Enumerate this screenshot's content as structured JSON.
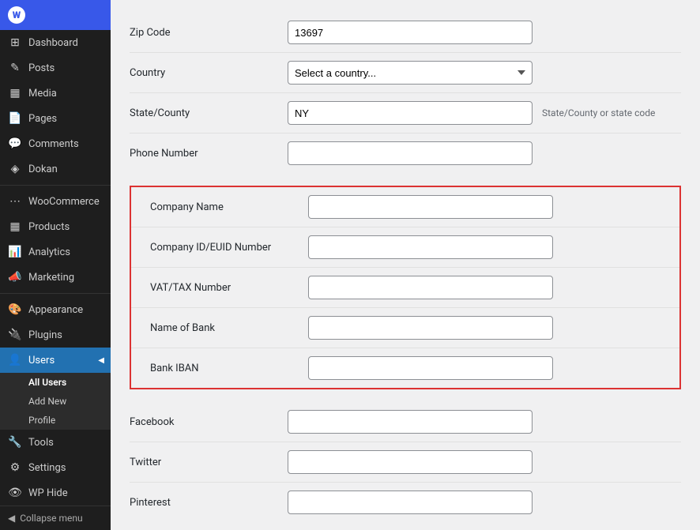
{
  "sidebar": {
    "logo": "W",
    "items": [
      {
        "id": "dashboard",
        "label": "Dashboard",
        "icon": "⊞"
      },
      {
        "id": "posts",
        "label": "Posts",
        "icon": "✎"
      },
      {
        "id": "media",
        "label": "Media",
        "icon": "🖼"
      },
      {
        "id": "pages",
        "label": "Pages",
        "icon": "📄"
      },
      {
        "id": "comments",
        "label": "Comments",
        "icon": "💬"
      },
      {
        "id": "dokan",
        "label": "Dokan",
        "icon": "🏪"
      },
      {
        "id": "woocommerce",
        "label": "WooCommerce",
        "icon": "🛒"
      },
      {
        "id": "products",
        "label": "Products",
        "icon": "📦"
      },
      {
        "id": "analytics",
        "label": "Analytics",
        "icon": "📊"
      },
      {
        "id": "marketing",
        "label": "Marketing",
        "icon": "📣"
      },
      {
        "id": "appearance",
        "label": "Appearance",
        "icon": "🎨"
      },
      {
        "id": "plugins",
        "label": "Plugins",
        "icon": "🔌"
      },
      {
        "id": "users",
        "label": "Users",
        "icon": "👤",
        "active": true
      },
      {
        "id": "tools",
        "label": "Tools",
        "icon": "🔧"
      },
      {
        "id": "settings",
        "label": "Settings",
        "icon": "⚙"
      },
      {
        "id": "wphide",
        "label": "WP Hide",
        "icon": "👁"
      }
    ],
    "submenu": {
      "all_users": "All Users",
      "add_new": "Add New",
      "profile": "Profile"
    },
    "collapse": "Collapse menu"
  },
  "form": {
    "fields": [
      {
        "id": "zip-code",
        "label": "Zip Code",
        "value": "13697",
        "type": "text",
        "hint": ""
      },
      {
        "id": "country",
        "label": "Country",
        "value": "Select a country...",
        "type": "select",
        "hint": ""
      },
      {
        "id": "state",
        "label": "State/County",
        "value": "NY",
        "type": "text",
        "hint": "State/County or state code"
      },
      {
        "id": "phone",
        "label": "Phone Number",
        "value": "",
        "type": "text",
        "hint": ""
      }
    ],
    "bordered_fields": [
      {
        "id": "company-name",
        "label": "Company Name",
        "value": "",
        "type": "text"
      },
      {
        "id": "company-id",
        "label": "Company ID/EUID Number",
        "value": "",
        "type": "text"
      },
      {
        "id": "vat-tax",
        "label": "VAT/TAX Number",
        "value": "",
        "type": "text"
      },
      {
        "id": "bank-name",
        "label": "Name of Bank",
        "value": "",
        "type": "text"
      },
      {
        "id": "bank-iban",
        "label": "Bank IBAN",
        "value": "",
        "type": "text"
      }
    ],
    "social_fields": [
      {
        "id": "facebook",
        "label": "Facebook",
        "value": "",
        "type": "text"
      },
      {
        "id": "twitter",
        "label": "Twitter",
        "value": "",
        "type": "text"
      },
      {
        "id": "pinterest",
        "label": "Pinterest",
        "value": "",
        "type": "text"
      }
    ]
  }
}
